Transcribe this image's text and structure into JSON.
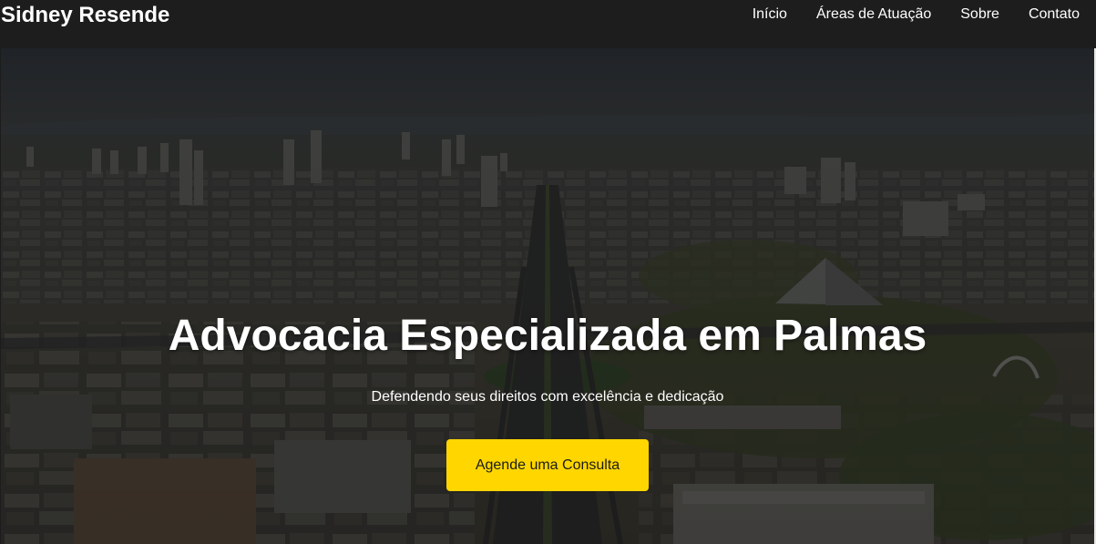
{
  "header": {
    "brand": "Sidney Resende",
    "nav": [
      {
        "label": "Início"
      },
      {
        "label": "Áreas de Atuação"
      },
      {
        "label": "Sobre"
      },
      {
        "label": "Contato"
      }
    ]
  },
  "hero": {
    "title": "Advocacia Especializada em Palmas",
    "subtitle": "Defendendo seus direitos com excelência e dedicação",
    "cta_label": "Agende uma Consulta",
    "background": "aerial-city-photo"
  },
  "colors": {
    "header_bg": "#1d1d1d",
    "accent": "#ffd600",
    "hero_overlay": "rgba(0,0,0,0.55)",
    "text": "#ffffff"
  }
}
